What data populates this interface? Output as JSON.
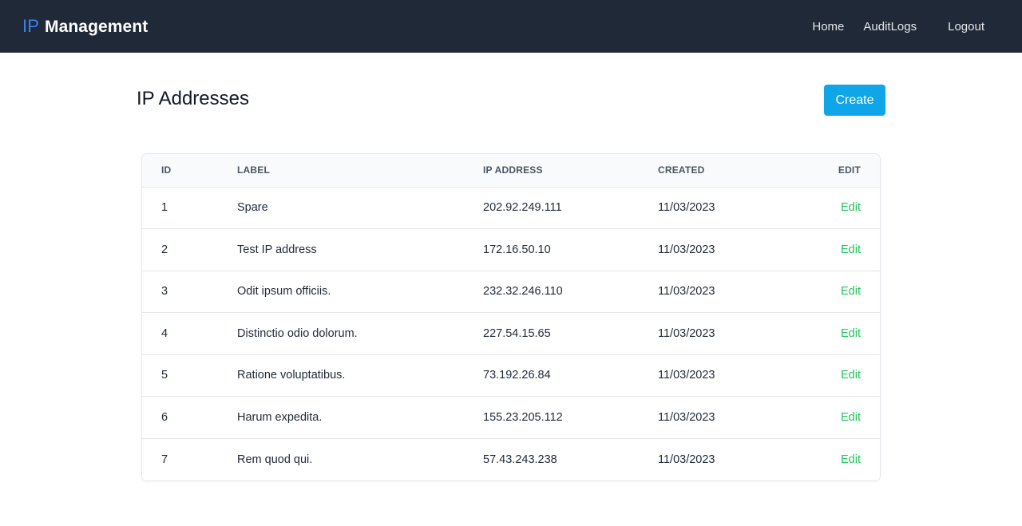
{
  "navbar": {
    "brand_ip": "IP",
    "brand_name": "Management",
    "links": {
      "home": "Home",
      "audit_logs": "AuditLogs",
      "logout": "Logout"
    }
  },
  "page": {
    "title": "IP Addresses",
    "create_label": "Create"
  },
  "table": {
    "headers": {
      "id": "ID",
      "label": "LABEL",
      "ip_address": "IP ADDRESS",
      "created": "CREATED",
      "edit": "EDIT"
    },
    "rows": [
      {
        "id": "1",
        "label": "Spare",
        "ip": "202.92.249.111",
        "created": "11/03/2023",
        "edit": "Edit"
      },
      {
        "id": "2",
        "label": "Test IP address",
        "ip": "172.16.50.10",
        "created": "11/03/2023",
        "edit": "Edit"
      },
      {
        "id": "3",
        "label": "Odit ipsum officiis.",
        "ip": "232.32.246.110",
        "created": "11/03/2023",
        "edit": "Edit"
      },
      {
        "id": "4",
        "label": "Distinctio odio dolorum.",
        "ip": "227.54.15.65",
        "created": "11/03/2023",
        "edit": "Edit"
      },
      {
        "id": "5",
        "label": "Ratione voluptatibus.",
        "ip": "73.192.26.84",
        "created": "11/03/2023",
        "edit": "Edit"
      },
      {
        "id": "6",
        "label": "Harum expedita.",
        "ip": "155.23.205.112",
        "created": "11/03/2023",
        "edit": "Edit"
      },
      {
        "id": "7",
        "label": "Rem quod qui.",
        "ip": "57.43.243.238",
        "created": "11/03/2023",
        "edit": "Edit"
      }
    ]
  },
  "colors": {
    "navbar_bg": "#1f2937",
    "brand_accent": "#3b82f6",
    "create_button": "#0ea5e9",
    "edit_link": "#22c55e"
  }
}
